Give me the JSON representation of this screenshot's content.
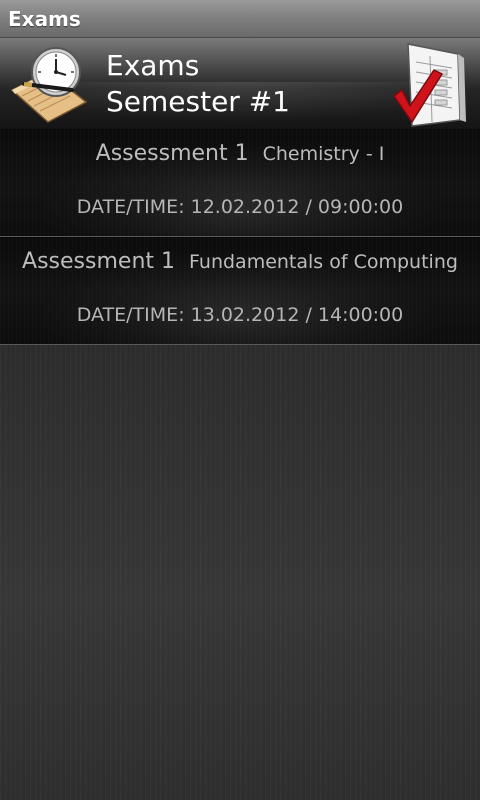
{
  "window": {
    "title": "Exams"
  },
  "header": {
    "line1": "Exams",
    "line2": "Semester #1",
    "left_icon": "clock-notepad-icon",
    "right_icon": "checklist-checkmark-icon"
  },
  "exams": [
    {
      "assessment": "Assessment 1",
      "subject": "Chemistry - I",
      "datetime": "DATE/TIME: 12.02.2012 / 09:00:00"
    },
    {
      "assessment": "Assessment 1",
      "subject": "Fundamentals of Computing",
      "datetime": "DATE/TIME: 13.02.2012 / 14:00:00"
    }
  ],
  "colors": {
    "checkmark": "#d0121b",
    "notepad": "#e8c48a"
  }
}
